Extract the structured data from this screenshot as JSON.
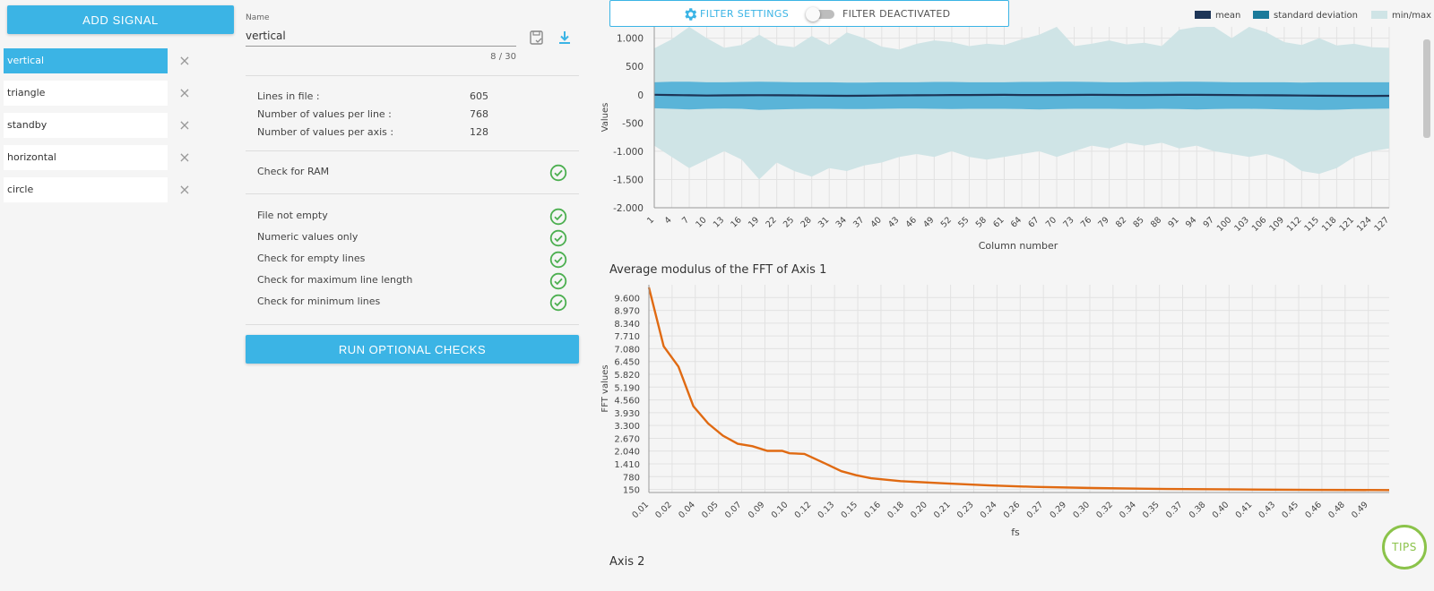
{
  "sidebar": {
    "add_signal_label": "ADD SIGNAL",
    "signals": [
      {
        "label": "vertical",
        "active": true
      },
      {
        "label": "triangle",
        "active": false
      },
      {
        "label": "standby",
        "active": false
      },
      {
        "label": "horizontal",
        "active": false
      },
      {
        "label": "circle",
        "active": false
      }
    ],
    "remove_glyph": "×"
  },
  "form": {
    "name_label": "Name",
    "name_value": "vertical",
    "char_count": "8 / 30",
    "save_icon": "save-icon",
    "download_icon": "download-icon"
  },
  "stats": [
    {
      "label": "Lines in file :",
      "value": "605"
    },
    {
      "label": "Number of values per line :",
      "value": "768"
    },
    {
      "label": "Number of values per axis :",
      "value": "128"
    }
  ],
  "ram_check": {
    "label": "Check for RAM",
    "status": "passed"
  },
  "checks": [
    {
      "label": "File not empty",
      "status": "passed"
    },
    {
      "label": "Numeric values only",
      "status": "passed"
    },
    {
      "label": "Check for empty lines",
      "status": "passed"
    },
    {
      "label": "Check for maximum line length",
      "status": "passed"
    },
    {
      "label": "Check for minimum lines",
      "status": "passed"
    }
  ],
  "run_button_label": "RUN OPTIONAL CHECKS",
  "filter": {
    "settings_label": "FILTER SETTINGS",
    "status_label": "FILTER DEACTIVATED",
    "enabled": false
  },
  "legend": [
    {
      "label": "mean",
      "color": "#1d3557"
    },
    {
      "label": "standard deviation",
      "color": "#1a7a9a"
    },
    {
      "label": "min/max",
      "color": "#cfe4e6"
    }
  ],
  "sections": {
    "fft_title": "Average modulus of the FFT of Axis 1",
    "axis2_title": "Axis 2"
  },
  "tips_label": "TIPS",
  "colors": {
    "accent": "#3bb4e5",
    "success": "#4caf50",
    "fft_line": "#e06a12",
    "std_band": "#5ab4d8",
    "minmax_band": "#cfe4e6",
    "mean_line": "#1d3557"
  },
  "chart_data": [
    {
      "type": "area",
      "title": "",
      "xlabel": "Column number",
      "ylabel": "Values",
      "ylim": [
        -2000,
        1200
      ],
      "yticks": [
        -2000,
        -1500,
        -1000,
        -500,
        0,
        500,
        1000
      ],
      "ytick_labels": [
        "-2.000",
        "-1.500",
        "-1.000",
        "-500",
        "0",
        "500",
        "1.000"
      ],
      "xticks": [
        1,
        4,
        7,
        10,
        13,
        16,
        19,
        22,
        25,
        28,
        31,
        34,
        37,
        40,
        43,
        46,
        49,
        52,
        55,
        58,
        61,
        64,
        67,
        70,
        73,
        76,
        79,
        82,
        85,
        88,
        91,
        94,
        97,
        100,
        103,
        106,
        109,
        112,
        115,
        118,
        121,
        124,
        127
      ],
      "x": [
        1,
        4,
        7,
        10,
        13,
        16,
        19,
        22,
        25,
        28,
        31,
        34,
        37,
        40,
        43,
        46,
        49,
        52,
        55,
        58,
        61,
        64,
        67,
        70,
        73,
        76,
        79,
        82,
        85,
        88,
        91,
        94,
        97,
        100,
        103,
        106,
        109,
        112,
        115,
        118,
        121,
        124,
        127
      ],
      "series": [
        {
          "name": "min/max",
          "max": [
            820,
            980,
            1240,
            1000,
            830,
            880,
            1060,
            880,
            840,
            1040,
            880,
            1100,
            1000,
            850,
            800,
            900,
            960,
            930,
            860,
            900,
            880,
            980,
            1060,
            1200,
            860,
            900,
            960,
            890,
            920,
            860,
            1150,
            1250,
            1250,
            1000,
            1250,
            1100,
            930,
            880,
            1000,
            870,
            900,
            840,
            830
          ],
          "min": [
            -900,
            -1100,
            -1300,
            -1150,
            -1000,
            -1150,
            -1500,
            -1200,
            -1350,
            -1450,
            -1300,
            -1350,
            -1250,
            -1200,
            -1100,
            -1050,
            -1100,
            -1000,
            -1100,
            -1150,
            -1100,
            -1050,
            -1000,
            -1100,
            -1000,
            -900,
            -950,
            -850,
            -900,
            -850,
            -950,
            -900,
            -1000,
            -1050,
            -1100,
            -1050,
            -1150,
            -1350,
            -1400,
            -1300,
            -1100,
            -1000,
            -950
          ]
        },
        {
          "name": "standard deviation",
          "upper": [
            220,
            230,
            230,
            220,
            220,
            225,
            230,
            225,
            220,
            220,
            220,
            215,
            215,
            220,
            220,
            220,
            225,
            225,
            220,
            220,
            220,
            225,
            225,
            230,
            230,
            225,
            220,
            220,
            225,
            225,
            230,
            230,
            225,
            220,
            220,
            220,
            220,
            215,
            220,
            220,
            220,
            220,
            220
          ],
          "lower": [
            -240,
            -250,
            -260,
            -250,
            -245,
            -250,
            -270,
            -260,
            -255,
            -250,
            -250,
            -255,
            -255,
            -250,
            -245,
            -245,
            -250,
            -255,
            -250,
            -250,
            -250,
            -255,
            -260,
            -255,
            -250,
            -250,
            -250,
            -255,
            -255,
            -250,
            -255,
            -260,
            -255,
            -250,
            -250,
            -255,
            -260,
            -265,
            -270,
            -265,
            -255,
            -250,
            -245
          ]
        },
        {
          "name": "mean",
          "values": [
            0,
            -5,
            -10,
            -15,
            -12,
            -10,
            -8,
            -10,
            -12,
            -15,
            -18,
            -20,
            -18,
            -15,
            -12,
            -10,
            -8,
            -6,
            -5,
            -4,
            -3,
            -5,
            -6,
            -5,
            -4,
            -3,
            -4,
            -5,
            -6,
            -4,
            -3,
            -2,
            -4,
            -6,
            -8,
            -10,
            -12,
            -15,
            -18,
            -20,
            -22,
            -22,
            -20
          ]
        }
      ]
    },
    {
      "type": "line",
      "title": "Average modulus of the FFT of Axis 1",
      "xlabel": "fs",
      "ylabel": "FFT values",
      "ylim": [
        0,
        10230
      ],
      "yticks": [
        150,
        780,
        1410,
        2040,
        2670,
        3300,
        3930,
        4560,
        5190,
        5820,
        6450,
        7080,
        7710,
        8340,
        8970,
        9600
      ],
      "ytick_labels": [
        "150",
        "780",
        "1.410",
        "2.040",
        "2.670",
        "3.300",
        "3.930",
        "4.560",
        "5.190",
        "5.820",
        "6.450",
        "7.080",
        "7.710",
        "8.340",
        "8.970",
        "9.600"
      ],
      "xlim": [
        0.0,
        0.5
      ],
      "xtick_labels": [
        "0.01",
        "0.02",
        "0.04",
        "0.05",
        "0.07",
        "0.09",
        "0.10",
        "0.12",
        "0.13",
        "0.15",
        "0.16",
        "0.18",
        "0.20",
        "0.21",
        "0.23",
        "0.24",
        "0.26",
        "0.27",
        "0.29",
        "0.30",
        "0.32",
        "0.34",
        "0.35",
        "0.37",
        "0.38",
        "0.40",
        "0.41",
        "0.43",
        "0.45",
        "0.46",
        "0.48",
        "0.49"
      ],
      "series": [
        {
          "name": "Axis 1",
          "x": [
            0.0,
            0.01,
            0.02,
            0.03,
            0.04,
            0.05,
            0.06,
            0.07,
            0.08,
            0.09,
            0.095,
            0.105,
            0.12,
            0.13,
            0.14,
            0.15,
            0.17,
            0.2,
            0.23,
            0.26,
            0.3,
            0.35,
            0.4,
            0.45,
            0.5
          ],
          "values": [
            10100,
            7200,
            6200,
            4250,
            3400,
            2800,
            2400,
            2280,
            2050,
            2050,
            1930,
            1900,
            1400,
            1050,
            850,
            700,
            560,
            450,
            350,
            280,
            220,
            170,
            150,
            130,
            120
          ]
        }
      ]
    }
  ]
}
